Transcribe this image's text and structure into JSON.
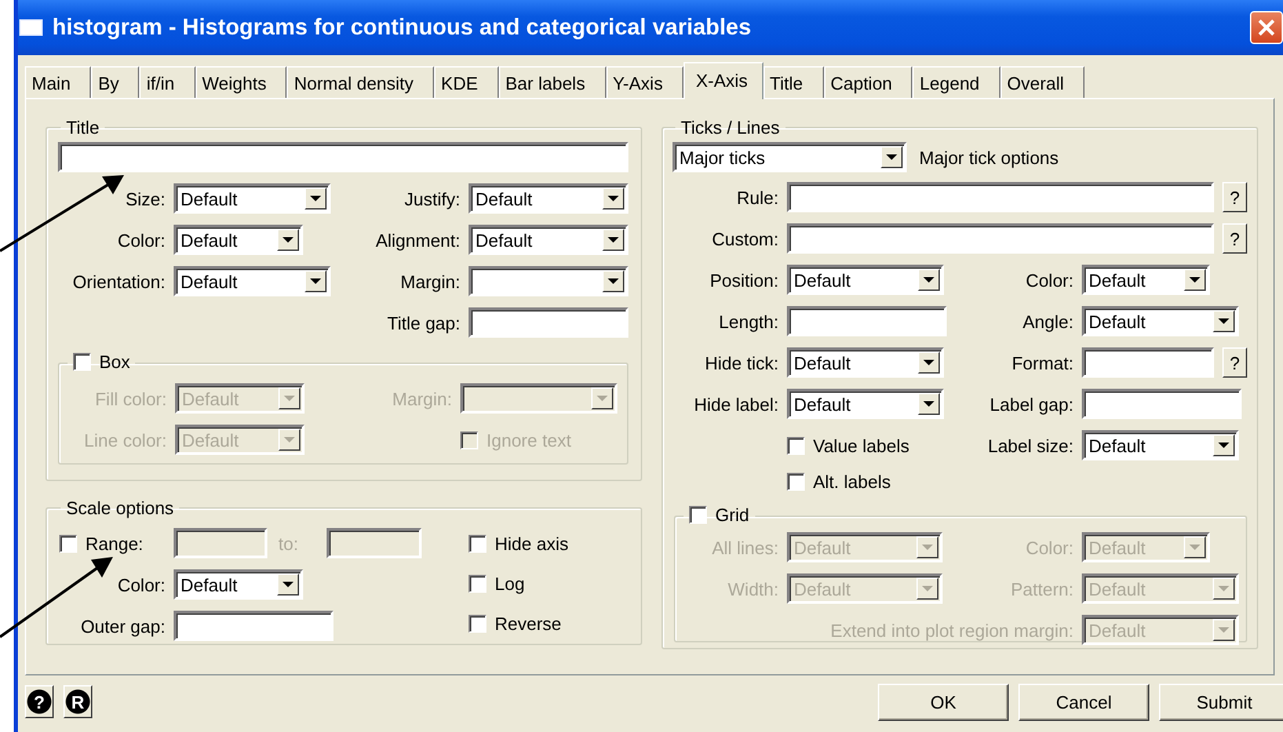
{
  "window": {
    "title": "histogram - Histograms for continuous and categorical variables"
  },
  "tabs": [
    {
      "label": "Main",
      "selected": false
    },
    {
      "label": "By",
      "selected": false
    },
    {
      "label": "if/in",
      "selected": false
    },
    {
      "label": "Weights",
      "selected": false
    },
    {
      "label": "Normal density",
      "selected": false
    },
    {
      "label": "KDE",
      "selected": false
    },
    {
      "label": "Bar labels",
      "selected": false
    },
    {
      "label": "Y-Axis",
      "selected": false
    },
    {
      "label": "X-Axis",
      "selected": true
    },
    {
      "label": "Title",
      "selected": false
    },
    {
      "label": "Caption",
      "selected": false
    },
    {
      "label": "Legend",
      "selected": false
    },
    {
      "label": "Overall",
      "selected": false
    }
  ],
  "title_section": {
    "legend": "Title",
    "fields": [
      {
        "kind": "dropdown",
        "label": "Size:",
        "value": "Default"
      },
      {
        "kind": "dropdown",
        "label": "Justify:",
        "value": "Default"
      },
      {
        "kind": "dropdown",
        "label": "Color:",
        "value": "Default"
      },
      {
        "kind": "dropdown",
        "label": "Alignment:",
        "value": "Default"
      },
      {
        "kind": "dropdown",
        "label": "Orientation:",
        "value": "Default"
      },
      {
        "kind": "dropdown",
        "label": "Margin:"
      },
      {
        "kind": "text",
        "label": "Title gap:"
      }
    ],
    "box": {
      "label": "Box",
      "checked": false,
      "fields": [
        {
          "kind": "dropdown",
          "label": "Fill color:",
          "value": "Default",
          "disabled": true
        },
        {
          "kind": "dropdown",
          "label": "Margin:",
          "disabled": true
        },
        {
          "kind": "dropdown",
          "label": "Line color:",
          "value": "Default",
          "disabled": true
        }
      ],
      "ignore_text": {
        "label": "Ignore text",
        "checked": false,
        "disabled": true
      }
    }
  },
  "scale_options": {
    "legend": "Scale options",
    "range": {
      "label": "Range:",
      "checked": false,
      "to_label": "to:",
      "disabled": true
    },
    "fields": [
      {
        "kind": "dropdown",
        "label": "Color:",
        "value": "Default"
      },
      {
        "kind": "text",
        "label": "Outer gap:"
      }
    ],
    "checks": [
      {
        "label": "Hide axis",
        "checked": false
      },
      {
        "label": "Log",
        "checked": false
      },
      {
        "label": "Reverse",
        "checked": false
      }
    ]
  },
  "ticks_lines": {
    "legend": "Ticks / Lines",
    "selector": {
      "value": "Major ticks"
    },
    "caption": "Major tick options",
    "fields": [
      {
        "kind": "text",
        "label": "Rule:",
        "help": "?"
      },
      {
        "kind": "text",
        "label": "Custom:",
        "help": "?"
      },
      {
        "kind": "dropdown",
        "label": "Position:",
        "value": "Default"
      },
      {
        "kind": "dropdown",
        "label": "Color:",
        "value": "Default"
      },
      {
        "kind": "text",
        "label": "Length:"
      },
      {
        "kind": "dropdown",
        "label": "Angle:",
        "value": "Default"
      },
      {
        "kind": "dropdown",
        "label": "Hide tick:",
        "value": "Default"
      },
      {
        "kind": "text",
        "label": "Format:",
        "help": "?"
      },
      {
        "kind": "dropdown",
        "label": "Hide label:",
        "value": "Default"
      },
      {
        "kind": "text",
        "label": "Label gap:"
      },
      {
        "kind": "dropdown",
        "label": "Label size:",
        "value": "Default"
      }
    ],
    "checks": [
      {
        "label": "Value labels",
        "checked": false
      },
      {
        "label": "Alt. labels",
        "checked": false
      }
    ],
    "grid": {
      "label": "Grid",
      "checked": false,
      "fields": [
        {
          "kind": "dropdown",
          "label": "All lines:",
          "value": "Default",
          "disabled": true
        },
        {
          "kind": "dropdown",
          "label": "Color:",
          "value": "Default",
          "disabled": true
        },
        {
          "kind": "dropdown",
          "label": "Width:",
          "value": "Default",
          "disabled": true
        },
        {
          "kind": "dropdown",
          "label": "Pattern:",
          "value": "Default",
          "disabled": true
        },
        {
          "kind": "dropdown",
          "label": "Extend into plot region margin:",
          "value": "Default",
          "disabled": true
        }
      ]
    }
  },
  "tool_buttons": [
    {
      "symbol": "?"
    },
    {
      "symbol": "R"
    }
  ],
  "buttons": [
    "OK",
    "Cancel",
    "Submit"
  ]
}
